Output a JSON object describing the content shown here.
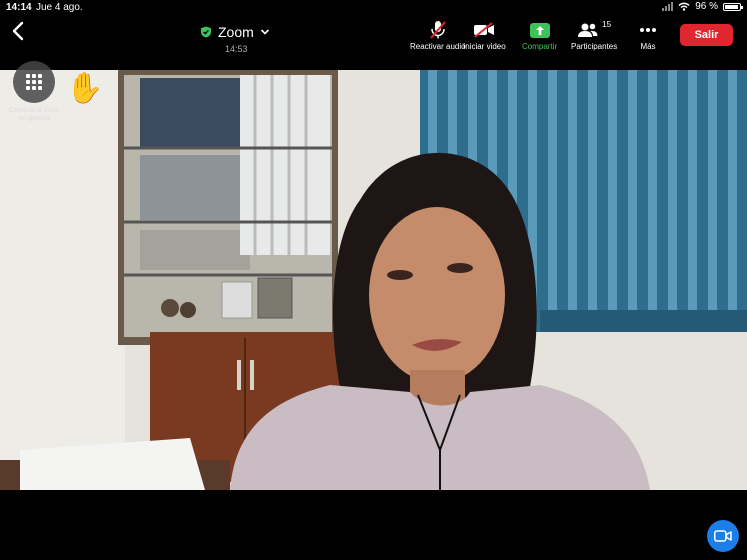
{
  "status": {
    "time": "14:14",
    "date": "Jue 4 ago.",
    "battery": "96 %"
  },
  "meeting": {
    "title": "Zoom",
    "timer": "14:53"
  },
  "toolbar": {
    "audio_label": "Reactivar audio",
    "video_label": "Iniciar video",
    "share_label": "Compartir",
    "participants_label": "Participantes",
    "participants_count": "15",
    "more_label": "Más",
    "leave_label": "Salir"
  },
  "overlay": {
    "switch_view_label": "Cambiar a Vista en galería"
  },
  "colors": {
    "accent_green": "#3ec35b",
    "leave_red": "#e0262e",
    "camera_blue": "#1b7ee9"
  }
}
